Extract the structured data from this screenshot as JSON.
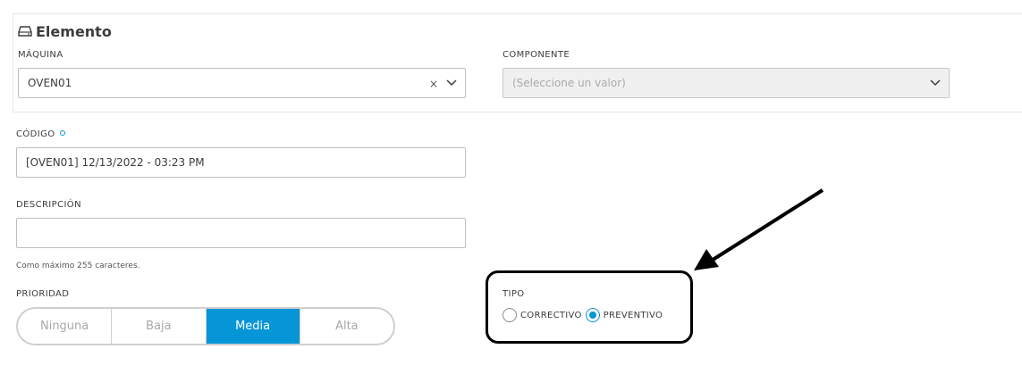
{
  "section": {
    "title": "Elemento",
    "icon": "drive-icon"
  },
  "maquina": {
    "label": "MÁQUINA",
    "value": "OVEN01",
    "clear": "×"
  },
  "componente": {
    "label": "COMPONENTE",
    "placeholder": "(Seleccione un valor)",
    "disabled": true
  },
  "codigo": {
    "label": "CÓDIGO",
    "value": "[OVEN01] 12/13/2022 - 03:23 PM",
    "required": true
  },
  "descripcion": {
    "label": "DESCRIPCIÓN",
    "value": "",
    "hint": "Como máximo 255 caracteres."
  },
  "prioridad": {
    "label": "PRIORIDAD",
    "options": [
      "Ninguna",
      "Baja",
      "Media",
      "Alta"
    ],
    "selected": "Media"
  },
  "tipo": {
    "label": "TIPO",
    "options": [
      "CORRECTIVO",
      "PREVENTIVO"
    ],
    "selected": "PREVENTIVO"
  },
  "colors": {
    "accent": "#0696d7",
    "highlight_box": "#000000"
  }
}
